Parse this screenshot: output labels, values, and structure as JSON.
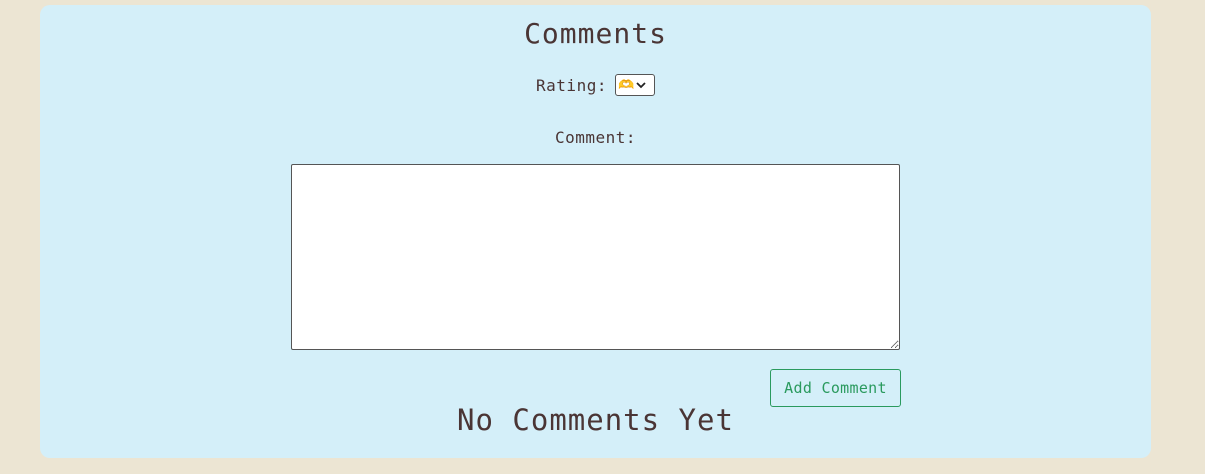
{
  "comments": {
    "title": "Comments",
    "rating_label": "Rating:",
    "rating_selected": "🫶",
    "comment_label": "Comment:",
    "comment_value": "",
    "add_button_label": "Add Comment",
    "empty_state": "No Comments Yet"
  },
  "colors": {
    "page_background": "#ece5d3",
    "panel_background": "#d4eff9",
    "text": "#4a3535",
    "accent_green": "#2a9a5e"
  }
}
